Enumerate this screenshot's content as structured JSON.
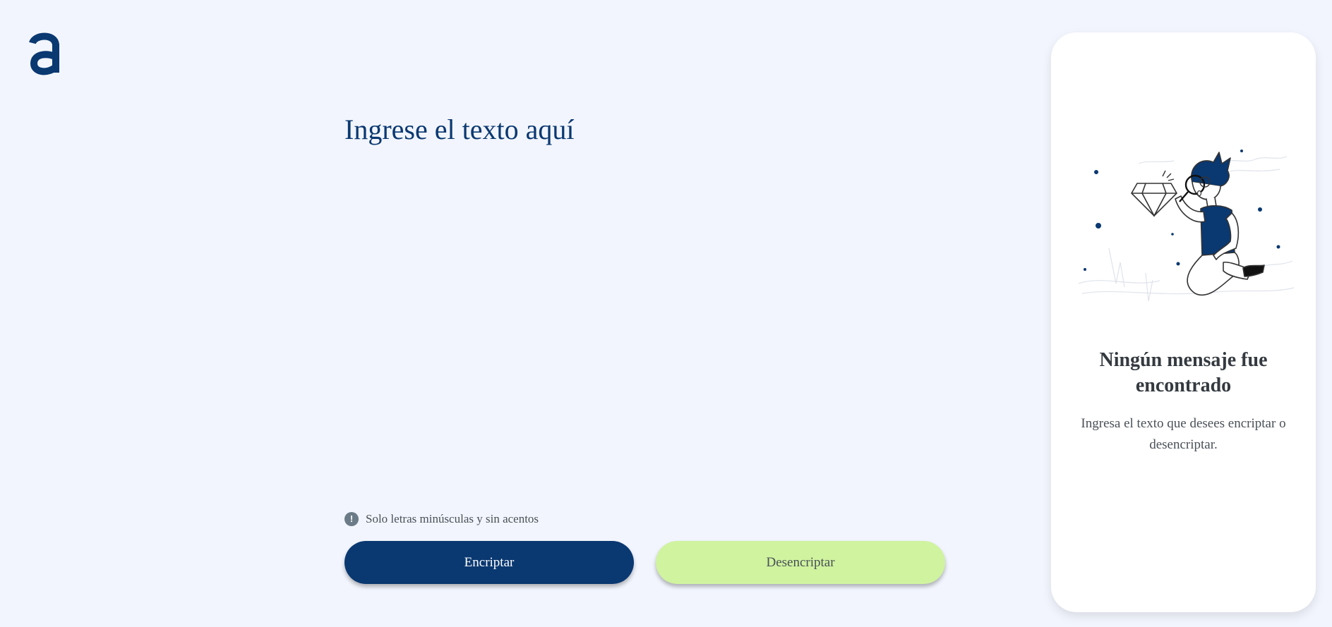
{
  "app": {
    "logo_icon": "alura-logo-icon",
    "colors": {
      "background": "#f2f5fd",
      "primary": "#0a3871",
      "secondary": "#d0f39f",
      "panel": "#ffffff",
      "text_muted": "#495057"
    }
  },
  "input": {
    "placeholder": "Ingrese el texto aquí",
    "value": ""
  },
  "hint": {
    "icon": "exclamation-circle-icon",
    "text": "Solo letras minúsculas y sin acentos"
  },
  "buttons": {
    "encrypt_label": "Encriptar",
    "decrypt_label": "Desencriptar"
  },
  "output_panel": {
    "illustration": "person-with-magnifying-glass-illustration",
    "title": "Ningún mensaje fue encontrado",
    "message": "Ingresa el texto que desees encriptar o desencriptar."
  }
}
